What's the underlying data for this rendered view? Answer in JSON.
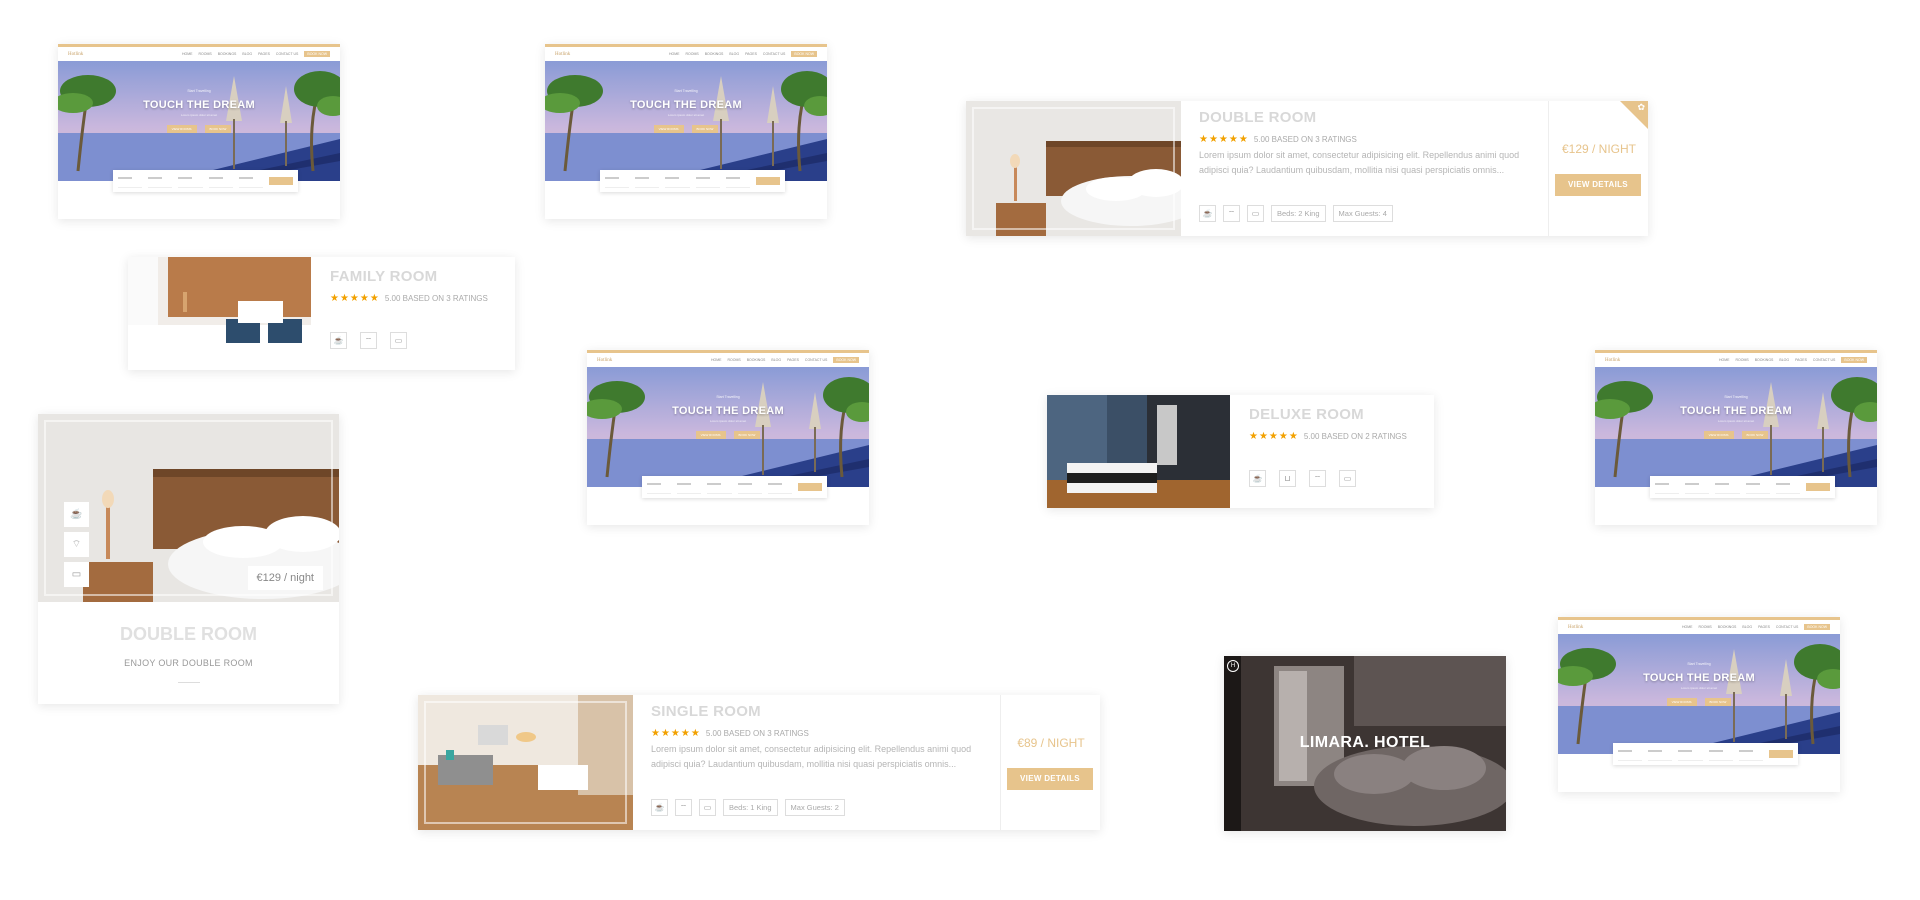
{
  "thumb": {
    "logo": "Hotlink",
    "menu": [
      "HOME",
      "ROOMS",
      "BOOKINGS",
      "BLOG",
      "PAGES",
      "CONTACT US"
    ],
    "book_label": "BOOK NOW",
    "hero_small": "Start Travelling",
    "hero_title": "TOUCH THE DREAM",
    "hero_sub": "Lorem ipsum dolor sit amet",
    "hero_btn_1": "VIEW ROOMS",
    "hero_btn_2": "BOOK NOW"
  },
  "double_room_list": {
    "title": "DOUBLE ROOM",
    "stars": "★★★★★",
    "rating_text": "5.00 BASED ON 3 RATINGS",
    "description": "Lorem ipsum dolor sit amet, consectetur adipisicing elit. Repellendus animi quod adipisci quia? Laudantium quibusdam, mollitia nisi quasi perspiciatis omnis...",
    "chips": [
      "Beds: 2 King",
      "Max Guests: 4"
    ],
    "price": "€129 / NIGHT",
    "button": "VIEW DETAILS",
    "badge_icon": "✿"
  },
  "family_room": {
    "title": "FAMILY ROOM",
    "stars": "★★★★★",
    "rating_text": "5.00 BASED ON 3 RATINGS"
  },
  "deluxe_room": {
    "title": "DELUXE ROOM",
    "stars": "★★★★★",
    "rating_text": "5.00 BASED ON 2 RATINGS"
  },
  "double_room_grid": {
    "price": "€129 / night",
    "title": "DOUBLE ROOM",
    "subtitle": "ENJOY OUR DOUBLE ROOM"
  },
  "single_room": {
    "title": "SINGLE ROOM",
    "stars": "★★★★★",
    "rating_text": "5.00 BASED ON 3 RATINGS",
    "description": "Lorem ipsum dolor sit amet, consectetur adipisicing elit. Repellendus animi quod adipisci quia? Laudantium quibusdam, mollitia nisi quasi perspiciatis omnis...",
    "chips": [
      "Beds: 1 King",
      "Max Guests: 2"
    ],
    "price": "€89 / NIGHT",
    "button": "VIEW DETAILS"
  },
  "hotel_card": {
    "logo_letter": "H",
    "name": "LIMARA. HOTEL"
  },
  "icons": {
    "coffee": "☕",
    "wifi": "⌔",
    "tv": "▭",
    "bath": "⊔"
  }
}
